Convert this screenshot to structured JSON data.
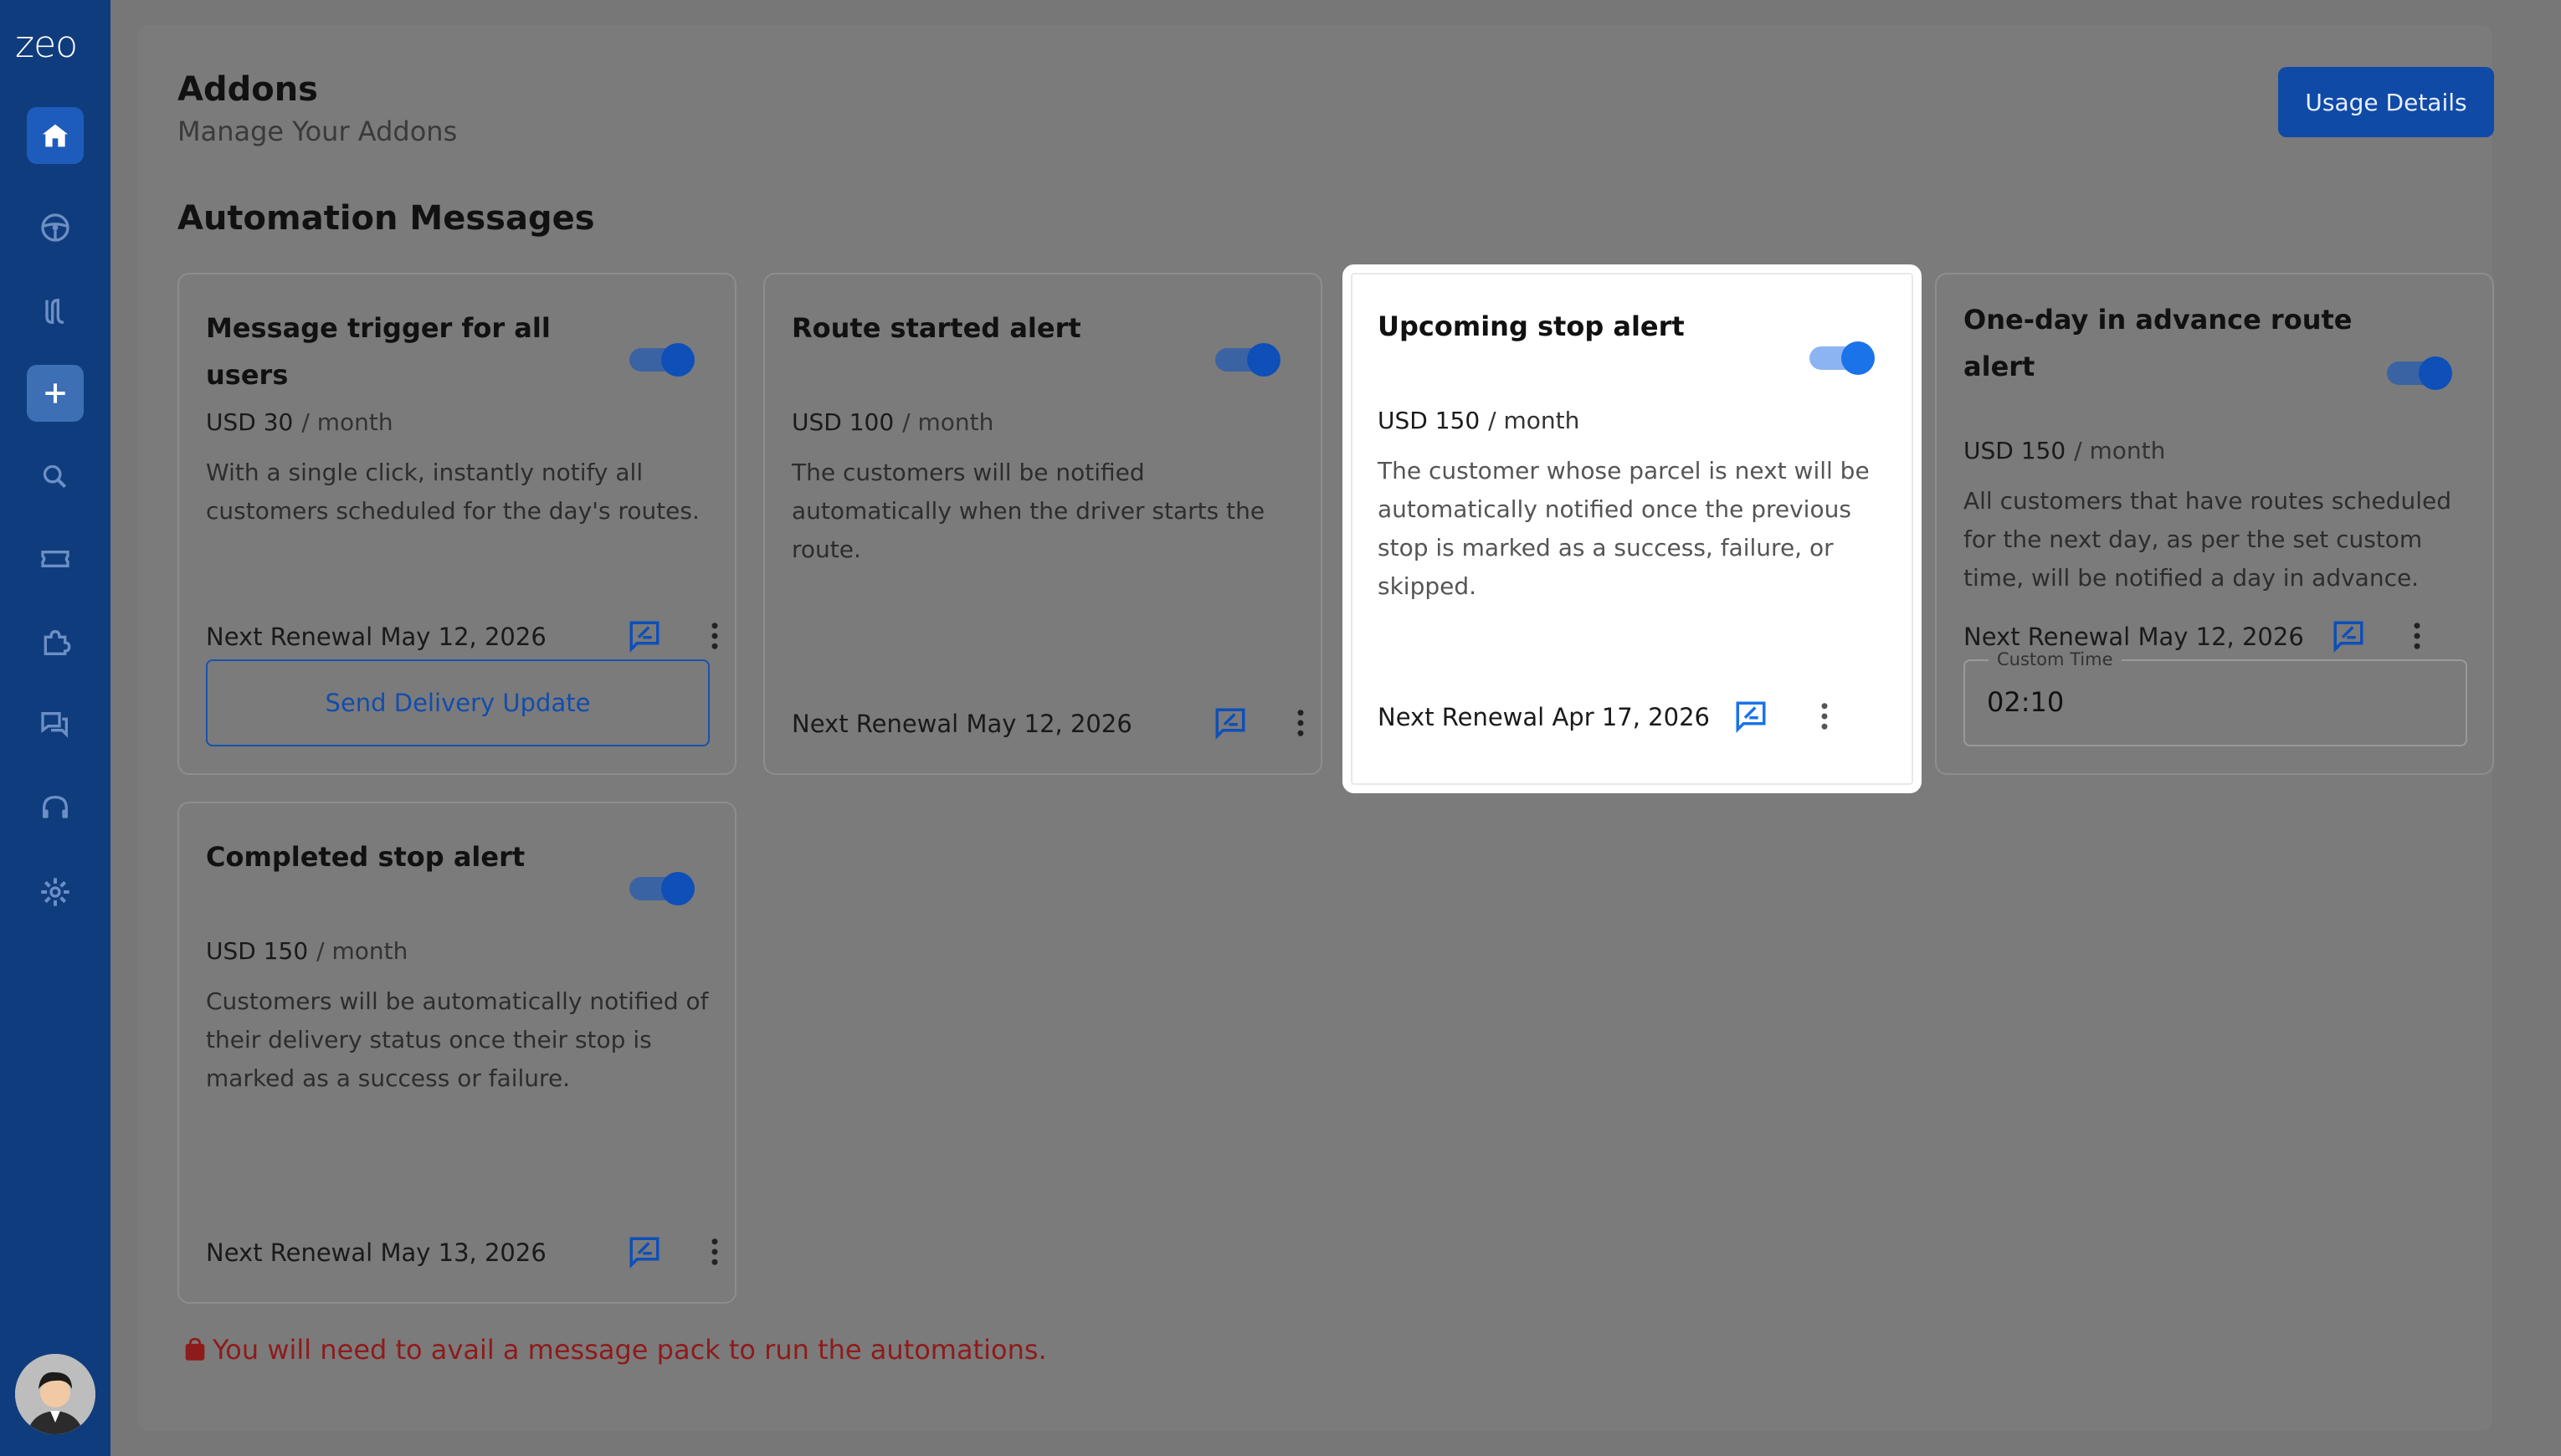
{
  "app": {
    "logo": "zeo"
  },
  "sidebar": {
    "items": [
      {
        "name": "home",
        "icon": "home-icon"
      },
      {
        "name": "steering",
        "icon": "steering-wheel-icon"
      },
      {
        "name": "routes",
        "icon": "route-icon"
      },
      {
        "name": "add",
        "icon": "plus-icon"
      },
      {
        "name": "search",
        "icon": "search-icon"
      },
      {
        "name": "tickets",
        "icon": "ticket-icon"
      },
      {
        "name": "addons",
        "icon": "puzzle-icon"
      },
      {
        "name": "messages",
        "icon": "chat-icon"
      },
      {
        "name": "support",
        "icon": "headset-icon"
      },
      {
        "name": "settings",
        "icon": "gear-icon"
      }
    ]
  },
  "header": {
    "title": "Addons",
    "subtitle": "Manage Your Addons",
    "usage_button": "Usage Details"
  },
  "section": {
    "title": "Automation Messages"
  },
  "cards": [
    {
      "title": "Message trigger for all users",
      "price": "USD 30",
      "period": "/ month",
      "description": "With a single click, instantly notify all customers scheduled for the day's routes.",
      "renewal": "Next Renewal May 12, 2026",
      "enabled": true,
      "action_label": "Send Delivery Update"
    },
    {
      "title": "Route started alert",
      "price": "USD 100",
      "period": "/ month",
      "description": "The customers will be notified automatically when the driver starts the route.",
      "renewal": "Next Renewal May 12, 2026",
      "enabled": true
    },
    {
      "title": "Upcoming stop alert",
      "price": "USD 150",
      "period": "/ month",
      "description": "The customer whose parcel is next will be automatically notified once the previous stop is marked as a success, failure, or skipped.",
      "renewal": "Next Renewal Apr 17, 2026",
      "enabled": true
    },
    {
      "title": "One-day in advance route alert",
      "price": "USD 150",
      "period": "/ month",
      "description": "All customers that have routes scheduled for the next day, as per the set custom time, will be notified a day in advance.",
      "renewal": "Next Renewal May 12, 2026",
      "enabled": true,
      "custom_time_label": "Custom Time",
      "custom_time_value": "02:10"
    },
    {
      "title": "Completed stop alert",
      "price": "USD 150",
      "period": "/ month",
      "description": "Customers will be automatically notified of their delivery status once their stop is marked as a success or failure.",
      "renewal": "Next Renewal May 13, 2026",
      "enabled": true
    }
  ],
  "warning": {
    "text": "You will need to avail a message pack to run the automations.",
    "icon": "shopping-bag-icon"
  },
  "colors": {
    "sidebar": "#0f3c7d",
    "accent": "#1a73e8",
    "warning": "#8e1b1b"
  }
}
